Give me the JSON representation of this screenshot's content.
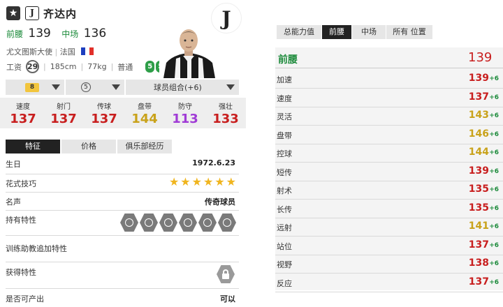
{
  "header": {
    "name": "齐达内",
    "club_mini": "J",
    "positions": [
      {
        "label": "前腰",
        "value": "139"
      },
      {
        "label": "中场",
        "value": "136"
      }
    ],
    "ambassador": "尤文图斯大使",
    "nation": "法国",
    "wage_label": "工资",
    "wage": "29",
    "height": "185cm",
    "weight": "77kg",
    "body": "普通",
    "left_foot": "5",
    "right_foot": "5",
    "club_logo": "J"
  },
  "selectors": {
    "level": "8",
    "upgrade": "5",
    "combo": "球员组合(+6)"
  },
  "main_stats": [
    {
      "label": "速度",
      "value": "137",
      "color": "#c81e1e"
    },
    {
      "label": "射门",
      "value": "137",
      "color": "#c81e1e"
    },
    {
      "label": "传球",
      "value": "137",
      "color": "#c81e1e"
    },
    {
      "label": "盘带",
      "value": "144",
      "color": "#c9a21a"
    },
    {
      "label": "防守",
      "value": "113",
      "color": "#a03bd6"
    },
    {
      "label": "强壮",
      "value": "133",
      "color": "#c81e1e"
    }
  ],
  "left_tabs": [
    "特征",
    "价格",
    "俱乐部经历"
  ],
  "details": {
    "birthday_label": "生日",
    "birthday": "1972.6.23",
    "skill_label": "花式技巧",
    "skill_stars": 6,
    "fame_label": "名声",
    "fame": "传奇球员",
    "traits_label": "持有特性",
    "traits": [
      "trait-icon-1",
      "trait-icon-2",
      "trait-icon-3",
      "trait-icon-4",
      "trait-icon-5",
      "trait-icon-6"
    ],
    "coach_label": "训练助教追加特性",
    "acquire_label": "获得特性",
    "produce_label": "是否可产出",
    "produce": "可以"
  },
  "right_tabs": [
    "总能力值",
    "前腰",
    "中场",
    "所有 位置"
  ],
  "right_header": {
    "label": "前腰",
    "value": "139"
  },
  "attributes": [
    {
      "label": "加速",
      "value": "139",
      "bonus": "+6",
      "color": "#c81e1e"
    },
    {
      "label": "速度",
      "value": "137",
      "bonus": "+6",
      "color": "#c81e1e"
    },
    {
      "label": "灵活",
      "value": "143",
      "bonus": "+6",
      "color": "#c9a21a"
    },
    {
      "label": "盘带",
      "value": "146",
      "bonus": "+6",
      "color": "#c9a21a"
    },
    {
      "label": "控球",
      "value": "144",
      "bonus": "+6",
      "color": "#c9a21a"
    },
    {
      "label": "短传",
      "value": "139",
      "bonus": "+6",
      "color": "#c81e1e"
    },
    {
      "label": "射术",
      "value": "135",
      "bonus": "+6",
      "color": "#c81e1e"
    },
    {
      "label": "长传",
      "value": "135",
      "bonus": "+6",
      "color": "#c81e1e"
    },
    {
      "label": "远射",
      "value": "141",
      "bonus": "+6",
      "color": "#c9a21a"
    },
    {
      "label": "站位",
      "value": "137",
      "bonus": "+6",
      "color": "#c81e1e"
    },
    {
      "label": "视野",
      "value": "138",
      "bonus": "+6",
      "color": "#c81e1e"
    },
    {
      "label": "反应",
      "value": "137",
      "bonus": "+6",
      "color": "#c81e1e"
    }
  ]
}
